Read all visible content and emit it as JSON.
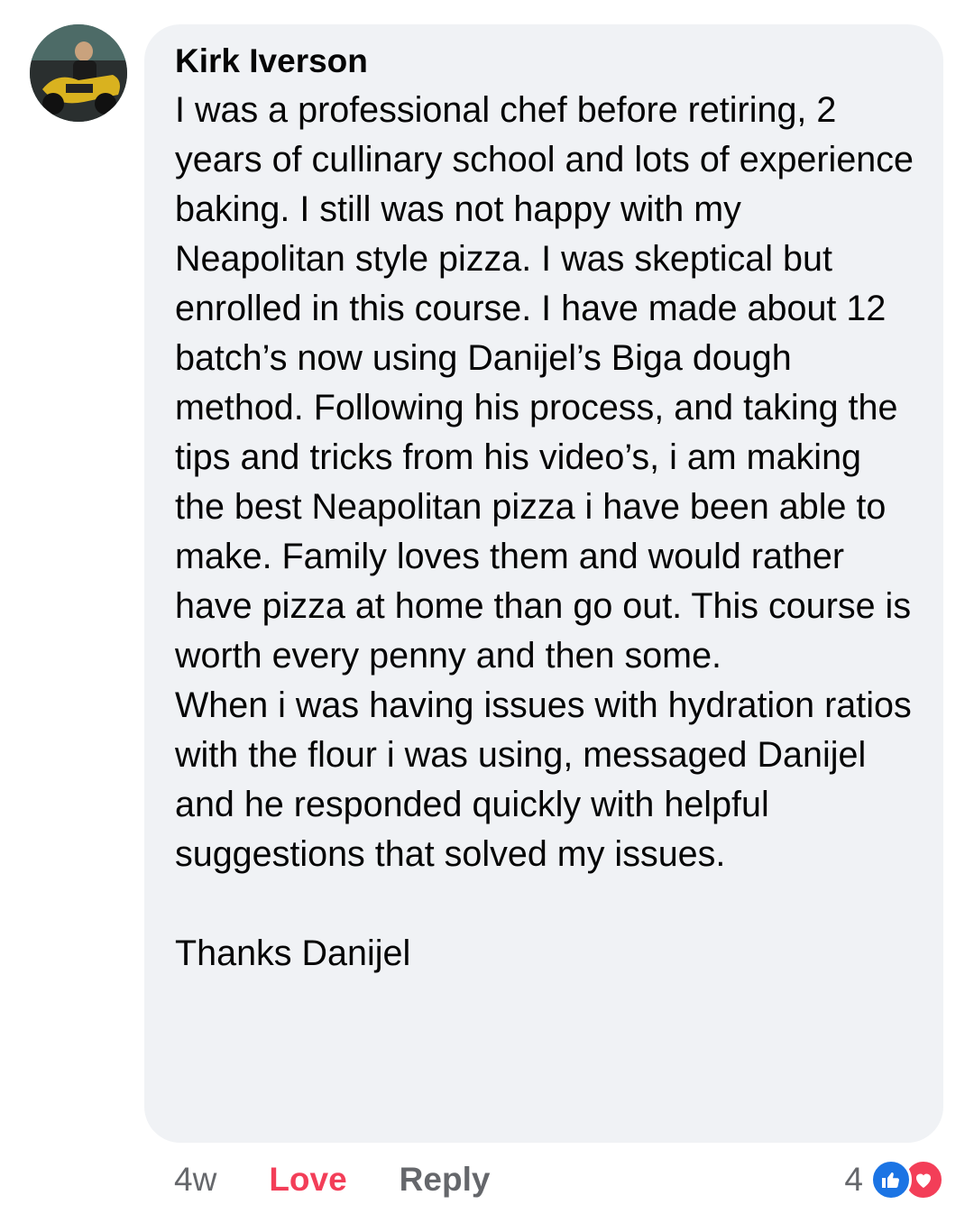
{
  "comment": {
    "author": "Kirk Iverson",
    "paragraphs": [
      "I was a professional chef before retiring, 2 years of cullinary school and lots of experience baking. I still was not happy with my Neapolitan style pizza. I was skeptical but enrolled in this course. I have made about 12 batch’s now using Danijel’s Biga dough method. Following his process, and taking the tips and tricks from his video’s, i am making the best Neapolitan pizza i have been able to make. Family loves them and would rather have pizza at home than go out. This course is worth every penny and then some.",
      "When i was having issues with hydration ratios with the flour i was using, messaged Danijel and he responded quickly with helpful suggestions that solved my issues.",
      "Thanks Danijel"
    ]
  },
  "actions": {
    "time": "4w",
    "love_label": "Love",
    "reply_label": "Reply"
  },
  "reactions": {
    "count": "4",
    "icons": [
      "like-icon",
      "heart-icon"
    ]
  },
  "colors": {
    "bubble_bg": "#f0f2f5",
    "love": "#f33e58",
    "like": "#1b74e4",
    "muted": "#65676b"
  }
}
